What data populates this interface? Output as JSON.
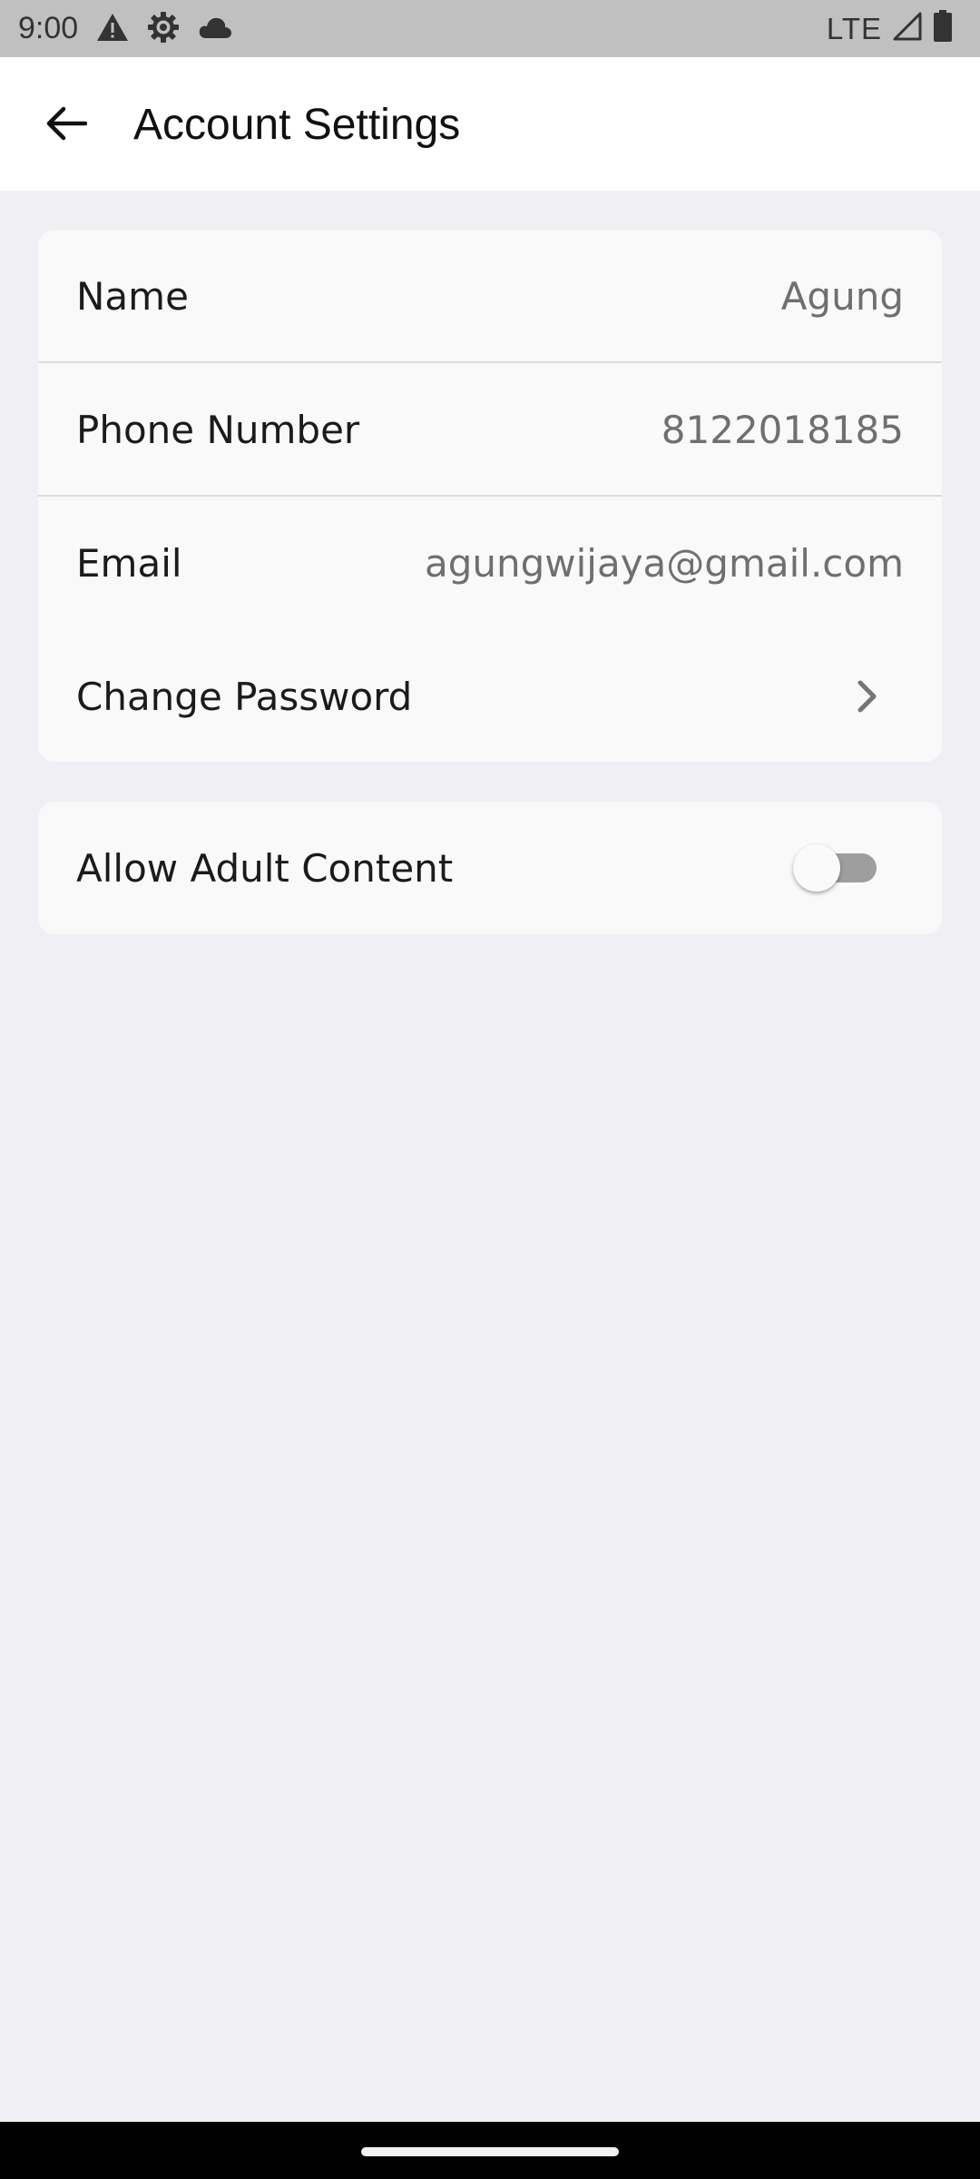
{
  "status_bar": {
    "time": "9:00",
    "network": "LTE",
    "icons": [
      "warning-icon",
      "settings-gear-icon",
      "cloud-icon",
      "signal-icon",
      "battery-icon"
    ]
  },
  "app_bar": {
    "title": "Account Settings",
    "back_icon": "back-arrow-icon"
  },
  "account": {
    "rows": [
      {
        "label": "Name",
        "value": "Agung"
      },
      {
        "label": "Phone Number",
        "value": "8122018185"
      },
      {
        "label": "Email",
        "value": "agungwijaya@gmail.com"
      },
      {
        "label": "Change Password",
        "icon": "chevron-right-icon"
      }
    ]
  },
  "content_settings": {
    "adult_content": {
      "label": "Allow Adult Content",
      "enabled": false
    }
  },
  "colors": {
    "background": "#f0eff4",
    "card": "#f9f9f9",
    "status_bar": "#c0c0c0",
    "value_text": "#6f6f6f",
    "toggle_off_track": "#9e9e9e"
  }
}
